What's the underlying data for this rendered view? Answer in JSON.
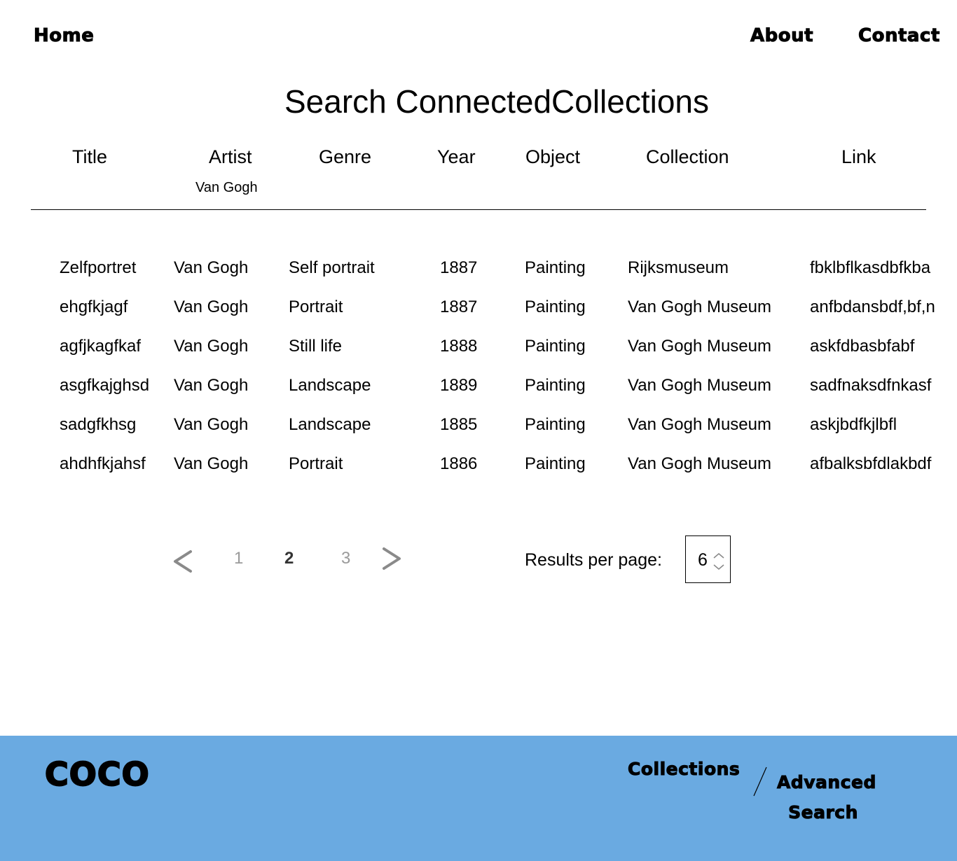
{
  "nav": {
    "home": "Home",
    "about": "About",
    "contact": "Contact"
  },
  "page_title": "Search ConnectedCollections",
  "table": {
    "columns": [
      "Title",
      "Artist",
      "Genre",
      "Year",
      "Object",
      "Collection",
      "Link"
    ],
    "artist_filter": "Van Gogh",
    "rows": [
      {
        "title": "Zelfportret",
        "artist": "Van Gogh",
        "genre": "Self portrait",
        "year": "1887",
        "object": "Painting",
        "collection": "Rijksmuseum",
        "link": "fbklbflkasdbfkba"
      },
      {
        "title": "ehgfkjagf",
        "artist": "Van Gogh",
        "genre": "Portrait",
        "year": "1887",
        "object": "Painting",
        "collection": "Van Gogh Museum",
        "link": "anfbdansbdf,bf,n"
      },
      {
        "title": "agfjkagfkaf",
        "artist": "Van Gogh",
        "genre": "Still life",
        "year": "1888",
        "object": "Painting",
        "collection": "Van Gogh Museum",
        "link": "askfdbasbfabf"
      },
      {
        "title": "asgfkajghsd",
        "artist": "Van Gogh",
        "genre": "Landscape",
        "year": "1889",
        "object": "Painting",
        "collection": "Van Gogh Museum",
        "link": "sadfnaksdfnkasf"
      },
      {
        "title": "sadgfkhsg",
        "artist": "Van Gogh",
        "genre": "Landscape",
        "year": "1885",
        "object": "Painting",
        "collection": "Van Gogh Museum",
        "link": "askjbdfkjlbfl"
      },
      {
        "title": "ahdhfkjahsf",
        "artist": "Van Gogh",
        "genre": "Portrait",
        "year": "1886",
        "object": "Painting",
        "collection": "Van Gogh Museum",
        "link": "afbalksbfdlakbdf"
      }
    ]
  },
  "pagination": {
    "pages": [
      "1",
      "2",
      "3"
    ],
    "current": "2",
    "prev_icon": "chevron-left-icon",
    "next_icon": "chevron-right-icon"
  },
  "results_per_page": {
    "label": "Results per page:",
    "value": "6"
  },
  "footer": {
    "logo": "COCO",
    "collections": "Collections",
    "advanced_search": "Advanced Search",
    "background": "#6aaae1"
  }
}
